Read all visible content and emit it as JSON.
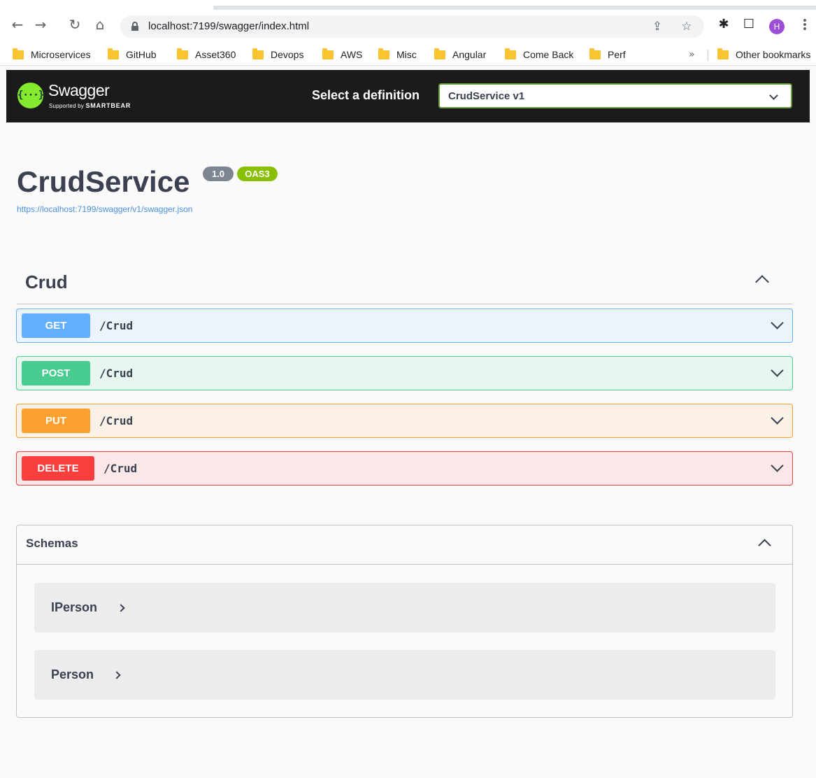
{
  "browser": {
    "url": "localhost:7199/swagger/index.html",
    "profile_initial": "H",
    "icons": [
      "back-icon",
      "forward-icon",
      "reload-icon",
      "home-icon",
      "lock-icon",
      "share-icon",
      "star-icon",
      "extensions-icon",
      "side-panel-icon",
      "menu-icon"
    ],
    "bookmarks": [
      "Microservices",
      "GitHub",
      "Asset360",
      "Devops",
      "AWS",
      "Misc",
      "Angular",
      "Come Back",
      "Perf"
    ],
    "bookmarks_overflow": "»",
    "other_bookmarks": "Other bookmarks"
  },
  "topbar": {
    "logo_title": "Swagger",
    "logo_subtitle_prefix": "Supported by",
    "logo_subtitle_brand": "SMARTBEAR",
    "select_label": "Select a definition",
    "selected_definition": "CrudService v1"
  },
  "info": {
    "title": "CrudService",
    "version": "1.0",
    "oas": "OAS3",
    "spec_url": "https://localhost:7199/swagger/v1/swagger.json"
  },
  "tag": {
    "name": "Crud",
    "operations": [
      {
        "method": "GET",
        "path": "/Crud",
        "color": "#61affe"
      },
      {
        "method": "POST",
        "path": "/Crud",
        "color": "#49cc90"
      },
      {
        "method": "PUT",
        "path": "/Crud",
        "color": "#fca130"
      },
      {
        "method": "DELETE",
        "path": "/Crud",
        "color": "#f93e3e"
      }
    ]
  },
  "schemas": {
    "title": "Schemas",
    "models": [
      "IPerson",
      "Person"
    ]
  },
  "colors": {
    "topbar_bg": "#1b1b1b",
    "swagger_green": "#85ea2d",
    "select_border": "#62a03f",
    "version_badge": "#7d8492",
    "oas_badge": "#89bf04",
    "link": "#4990e2"
  }
}
